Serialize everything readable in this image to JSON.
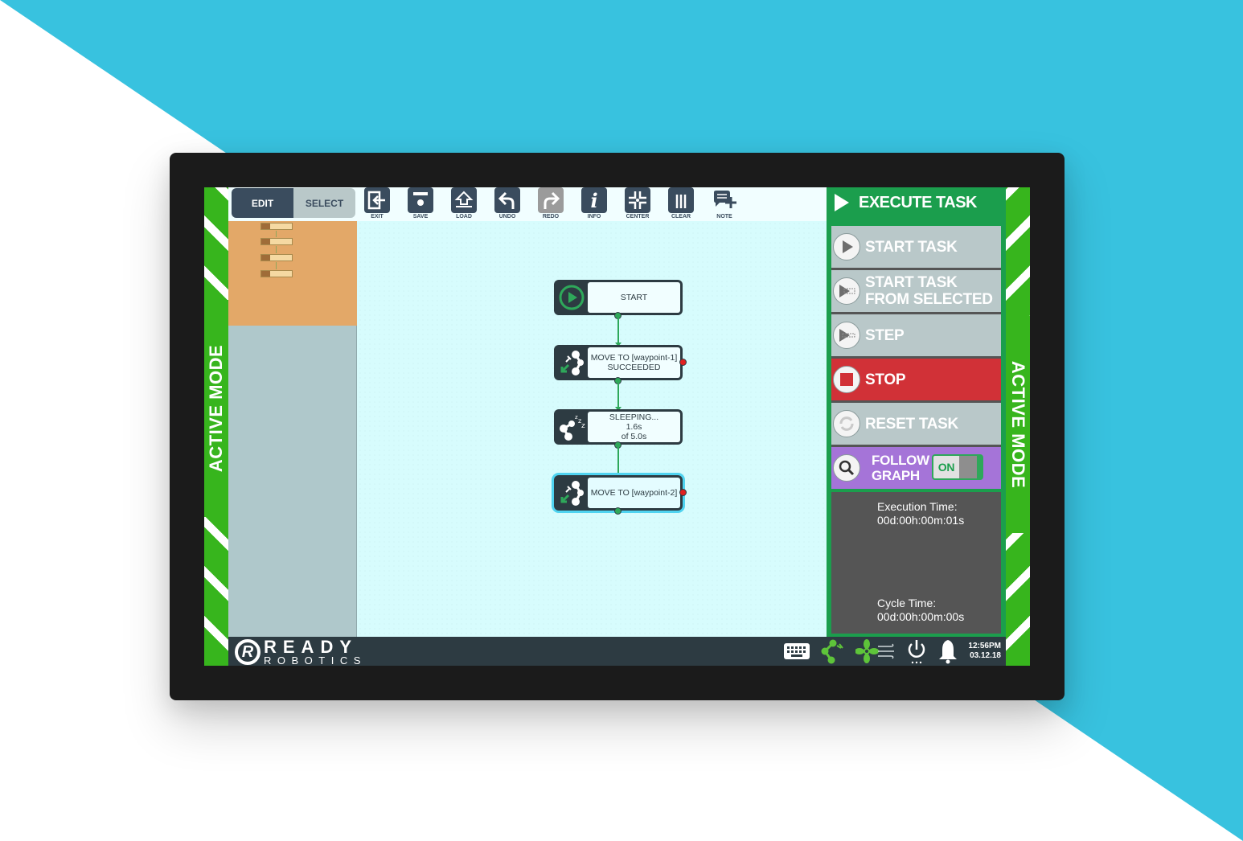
{
  "app": {
    "mode_banner": "ACTIVE MODE",
    "brand_line1": "READY",
    "brand_line2": "ROBOTICS",
    "brand_mark": "R"
  },
  "colors": {
    "background_accent": "#38c2df",
    "hazard_green": "#37b51d",
    "panel_green": "#1b9e4d",
    "stop_red": "#d13137",
    "follow_purple": "#a574d8",
    "toolbar_dark": "#3a4c5e",
    "canvas_bg": "#d7fcfd"
  },
  "toolbar": {
    "mode_tabs": [
      {
        "label": "EDIT",
        "active": true
      },
      {
        "label": "SELECT",
        "active": false
      }
    ],
    "tools": [
      {
        "label": "EXIT",
        "icon": "exit-icon",
        "enabled": true
      },
      {
        "label": "SAVE",
        "icon": "save-icon",
        "enabled": true
      },
      {
        "label": "LOAD",
        "icon": "load-icon",
        "enabled": true
      },
      {
        "label": "UNDO",
        "icon": "undo-icon",
        "enabled": true
      },
      {
        "label": "REDO",
        "icon": "redo-icon",
        "enabled": false
      },
      {
        "label": "INFO",
        "icon": "info-icon",
        "enabled": true
      },
      {
        "label": "CENTER",
        "icon": "center-icon",
        "enabled": true
      },
      {
        "label": "CLEAR",
        "icon": "trash-icon",
        "enabled": true
      },
      {
        "label": "NOTE",
        "icon": "note-add-icon",
        "enabled": true
      }
    ]
  },
  "graph": {
    "nodes": [
      {
        "id": "start",
        "icon": "play-icon",
        "lines": [
          "START"
        ],
        "selected": false,
        "has_error_port": false
      },
      {
        "id": "move1",
        "icon": "robot-arm-move-icon",
        "lines": [
          "MOVE TO [waypoint-1]",
          "SUCCEEDED"
        ],
        "selected": false,
        "has_error_port": true
      },
      {
        "id": "sleep",
        "icon": "robot-arm-sleep-icon",
        "lines": [
          "SLEEPING...",
          "1.6s",
          "of 5.0s"
        ],
        "selected": false,
        "has_error_port": false
      },
      {
        "id": "move2",
        "icon": "robot-arm-move-icon",
        "lines": [
          "MOVE TO [waypoint-2]"
        ],
        "selected": true,
        "has_error_port": true
      }
    ]
  },
  "execute_panel": {
    "title": "EXECUTE TASK",
    "buttons": [
      {
        "label": "START TASK",
        "icon": "play-circle-icon"
      },
      {
        "label_line1": "START TASK",
        "label_line2": "FROM SELECTED",
        "icon": "play-from-selected-icon"
      },
      {
        "label": "STEP",
        "icon": "step-icon"
      },
      {
        "label": "STOP",
        "icon": "stop-icon"
      },
      {
        "label": "RESET TASK",
        "icon": "reset-icon"
      }
    ],
    "follow_graph": {
      "label_line1": "FOLLOW",
      "label_line2": "GRAPH",
      "toggle_label": "ON",
      "enabled": true
    },
    "execution_time_label": "Execution Time:",
    "execution_time_value": "00d:00h:00m:01s",
    "cycle_time_label": "Cycle Time:",
    "cycle_time_value": "00d:00h:00m:00s"
  },
  "status_bar": {
    "icons": [
      "keyboard-icon",
      "robot-arm-status-icon",
      "fan-icon",
      "power-icon",
      "bell-icon"
    ],
    "time": "12:56PM",
    "date": "03.12.18"
  }
}
